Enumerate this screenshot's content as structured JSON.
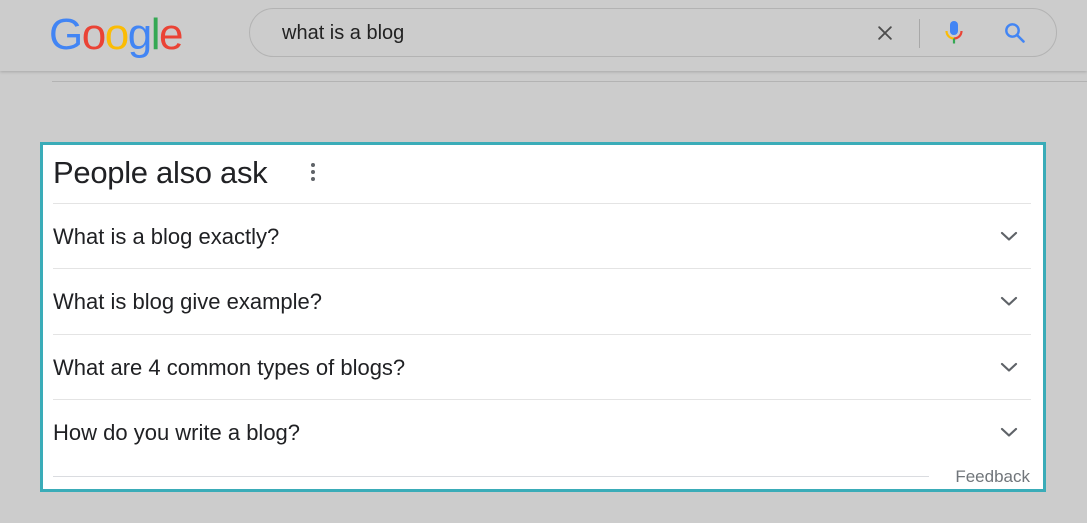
{
  "logo": {
    "letters": [
      "G",
      "o",
      "o",
      "g",
      "l",
      "e"
    ],
    "colors": [
      "#4285F4",
      "#EA4335",
      "#FBBC05",
      "#4285F4",
      "#34A853",
      "#EA4335"
    ]
  },
  "search": {
    "value": "what is a blog",
    "icons": {
      "clear": "close-icon",
      "voice": "microphone-icon",
      "submit": "search-icon"
    }
  },
  "people_also_ask": {
    "title": "People also ask",
    "menu_icon": "more-vert-icon",
    "questions": [
      "What is a blog exactly?",
      "What is blog give example?",
      "What are 4 common types of blogs?",
      "How do you write a blog?"
    ],
    "expand_icon": "chevron-down-icon",
    "feedback_label": "Feedback",
    "border_color": "#3aacb8"
  }
}
